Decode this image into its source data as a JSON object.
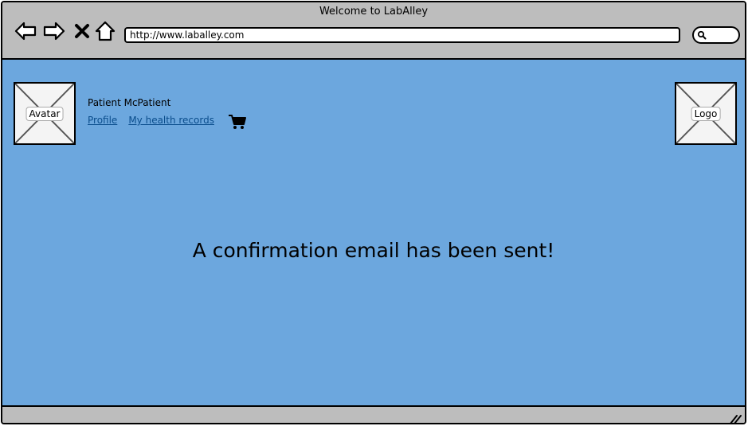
{
  "window": {
    "title": "Welcome to LabAlley",
    "url": "http://www.laballey.com"
  },
  "header": {
    "avatar_label": "Avatar",
    "logo_label": "Logo",
    "user_name": "Patient McPatient",
    "links": [
      {
        "label": "Profile"
      },
      {
        "label": "My health records"
      }
    ]
  },
  "main": {
    "message": "A confirmation email has been sent!"
  },
  "colors": {
    "content_bg": "#6ca7de",
    "chrome_bg": "#bdbdbd",
    "link": "#0a4d8c"
  },
  "icons": [
    "back-icon",
    "forward-icon",
    "close-icon",
    "home-icon",
    "search-icon",
    "cart-icon",
    "resize-grip-icon"
  ]
}
